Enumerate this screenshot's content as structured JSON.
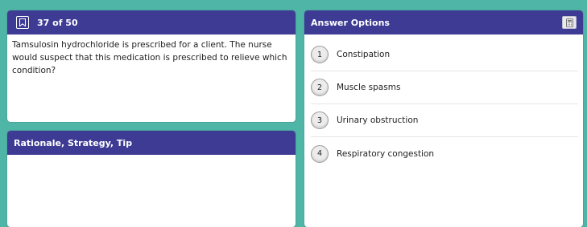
{
  "question": {
    "counter": "37 of 50",
    "text": "Tamsulosin hydrochloride is prescribed for a client. The nurse would suspect that this medication is prescribed to relieve which condition?"
  },
  "rationale": {
    "title": "Rationale, Strategy, Tip"
  },
  "answer_panel": {
    "title": "Answer Options",
    "options": [
      {
        "number": "1",
        "label": "Constipation"
      },
      {
        "number": "2",
        "label": "Muscle spasms"
      },
      {
        "number": "3",
        "label": "Urinary obstruction"
      },
      {
        "number": "4",
        "label": "Respiratory congestion"
      }
    ]
  },
  "colors": {
    "background": "#4fb5a6",
    "header": "#3d3b94",
    "panel": "#ffffff"
  },
  "icons": {
    "bookmark": "bookmark-icon",
    "calculator": "calculator-icon"
  }
}
